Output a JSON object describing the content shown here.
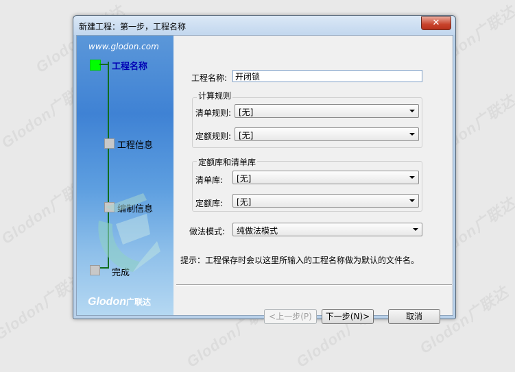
{
  "window": {
    "title": "新建工程：第一步，工程名称",
    "close_label": "✕"
  },
  "sidebar": {
    "url": "www.glodon.com",
    "steps": [
      {
        "label": "工程名称",
        "active": true
      },
      {
        "label": "工程信息",
        "active": false
      },
      {
        "label": "编制信息",
        "active": false
      },
      {
        "label": "完成",
        "active": false
      }
    ],
    "logo_text": "Glodon",
    "logo_cn": "广联达"
  },
  "form": {
    "project_name_label": "工程名称:",
    "project_name_value": "开闭锁",
    "calc_rules_group": "计算规则",
    "list_rule_label": "清单规则:",
    "list_rule_value": "[无]",
    "quota_rule_label": "定额规则:",
    "quota_rule_value": "[无]",
    "library_group": "定额库和清单库",
    "list_lib_label": "清单库:",
    "list_lib_value": "[无]",
    "quota_lib_label": "定额库:",
    "quota_lib_value": "[无]",
    "mode_label": "做法模式:",
    "mode_value": "纯做法模式",
    "hint": "提示：工程保存时会以这里所输入的工程名称做为默认的文件名。"
  },
  "buttons": {
    "prev": "<上一步(P)",
    "next": "下一步(N)>",
    "cancel": "取消"
  },
  "colors": {
    "active_step": "#00ff00",
    "sidebar_top": "#3f82d4",
    "close": "#c7412a"
  },
  "watermark": "Glodon广联达"
}
